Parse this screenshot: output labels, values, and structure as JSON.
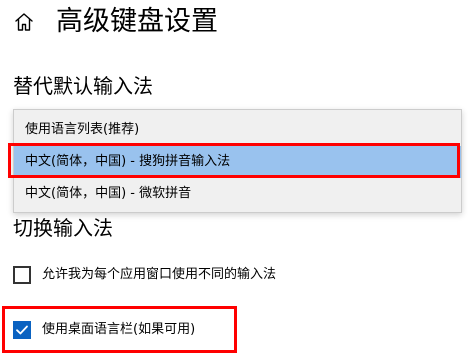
{
  "header": {
    "title": "高级键盘设置",
    "home_icon": "home-icon"
  },
  "default_input": {
    "section_title": "替代默认输入法",
    "dropdown": {
      "items": [
        {
          "label": "使用语言列表(推荐)"
        },
        {
          "label": "中文(简体，中国) - 搜狗拼音输入法",
          "highlighted": true
        },
        {
          "label": "中文(简体，中国) - 微软拼音"
        }
      ]
    }
  },
  "switch_input": {
    "section_title": "切换输入法",
    "options": [
      {
        "label": "允许我为每个应用窗口使用不同的输入法",
        "checked": false
      },
      {
        "label": "使用桌面语言栏(如果可用)",
        "checked": true
      }
    ]
  },
  "colors": {
    "highlight": "#99c2ee",
    "checkbox_checked": "#0a62c1",
    "annotation_red": "#ff0000"
  }
}
